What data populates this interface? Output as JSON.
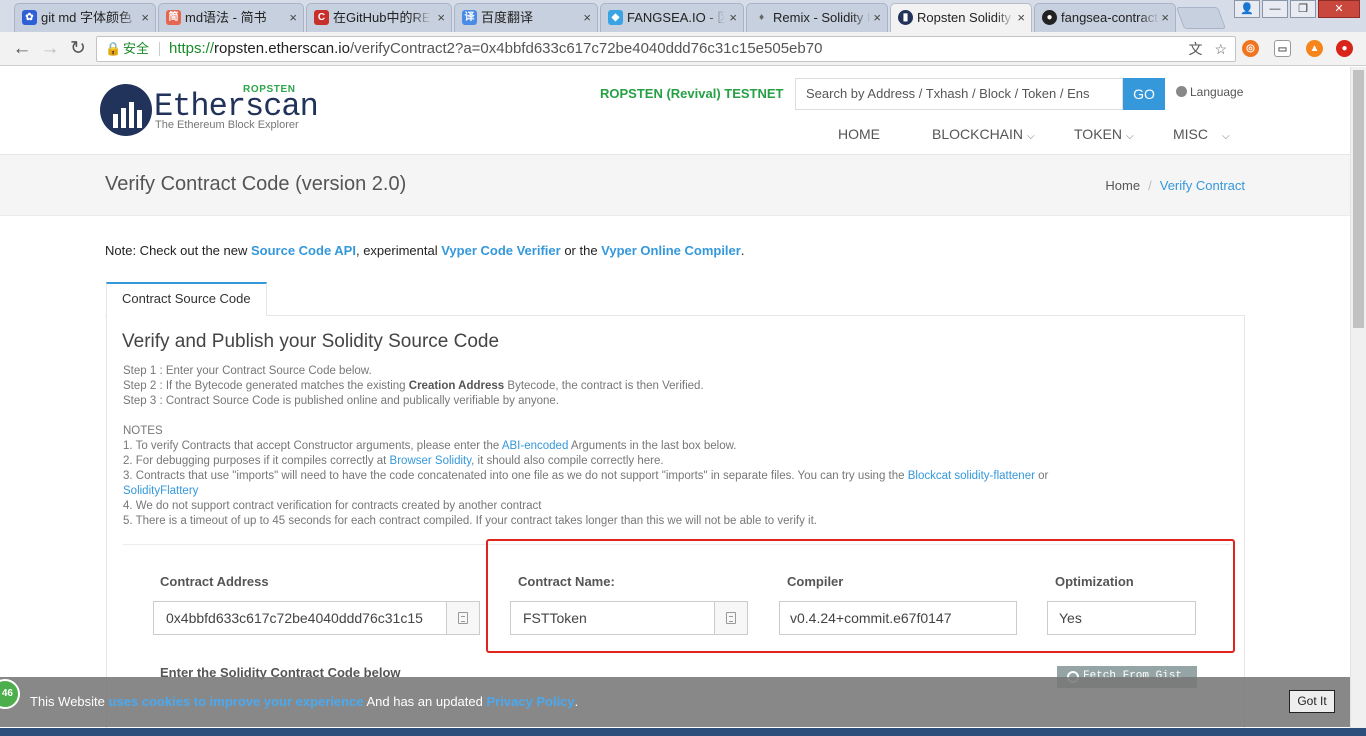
{
  "browser": {
    "tabs": [
      {
        "label": "git md 字体颜色",
        "icon": "paw-icon",
        "color": "#2e5fd6"
      },
      {
        "label": "md语法 - 简书",
        "icon": "jianshu-icon",
        "color": "#e6654f"
      },
      {
        "label": "在GitHub中的README",
        "icon": "csdn-icon",
        "color": "#c9302c"
      },
      {
        "label": "百度翻译",
        "icon": "translate-icon",
        "color": "#4a8be6"
      },
      {
        "label": "FANGSEA.IO - 区块链",
        "icon": "fangsea-icon",
        "color": "#3aa3e3"
      },
      {
        "label": "Remix - Solidity IDE",
        "icon": "ethereum-icon",
        "color": "#777777"
      },
      {
        "label": "Ropsten Solidity",
        "icon": "etherscan-icon",
        "color": "#21325b"
      },
      {
        "label": "fangsea-contract",
        "icon": "github-icon",
        "color": "#222222"
      }
    ],
    "secure_label": "安全",
    "url_scheme": "https://",
    "url_host": "ropsten.etherscan.io",
    "url_path": "/verifyContract2?a=0x4bbfd633c617c72be4040ddd76c31c15e505eb70"
  },
  "header": {
    "logo_network": "ROPSTEN",
    "logo_word": "Etherscan",
    "logo_tagline": "The Ethereum Block Explorer",
    "network_label": "ROPSTEN (Revival) TESTNET",
    "search_placeholder": "Search by Address / Txhash / Block / Token / Ens",
    "search_button": "GO",
    "language": "Language",
    "menu": [
      "HOME",
      "BLOCKCHAIN",
      "TOKEN",
      "MISC"
    ]
  },
  "page": {
    "title": "Verify Contract Code (version 2.0)",
    "breadcrumb_home": "Home",
    "breadcrumb_sep": "/",
    "breadcrumb_current": "Verify Contract"
  },
  "note": {
    "prefix": "Note: Check out the new ",
    "link1": "Source Code API",
    "mid1": ", experimental ",
    "link2": "Vyper Code Verifier",
    "mid2": " or the ",
    "link3": "Vyper Online Compiler",
    "suffix": "."
  },
  "tab_label": "Contract Source Code",
  "section": {
    "title": "Verify and Publish your Solidity Source Code",
    "step1": "Step 1 : Enter your Contract Source Code below.",
    "step2_a": "Step 2 : If the Bytecode generated matches the existing ",
    "step2_b": "Creation Address",
    "step2_c": " Bytecode, the contract is then Verified.",
    "step3": "Step 3 : Contract Source Code is published online and publically verifiable by anyone.",
    "notes_heading": "NOTES",
    "n1_a": "1. To verify Contracts that accept Constructor arguments, please enter the ",
    "n1_link": "ABI-encoded",
    "n1_b": " Arguments in the last box below.",
    "n2_a": "2. For debugging purposes if it compiles correctly at ",
    "n2_link": "Browser Solidity",
    "n2_b": ", it should also compile correctly here.",
    "n3_a": "3. Contracts that use \"imports\" will need to have the code concatenated into one file as we do not support \"imports\" in separate files. You can try using the ",
    "n3_link": "Blockcat solidity-flattener",
    "n3_b": " or",
    "n3_link2": "SolidityFlattery",
    "n4": "4. We do not support contract verification for contracts created by another contract",
    "n5": "5. There is a timeout of up to 45 seconds for each contract compiled. If your contract takes longer than this we will not be able to verify it."
  },
  "form": {
    "address_label": "Contract Address",
    "address_value": "0x4bbfd633c617c72be4040ddd76c31c15",
    "name_label": "Contract Name:",
    "name_value": "FSTToken",
    "compiler_label": "Compiler",
    "compiler_value": "v0.4.24+commit.e67f0147",
    "optimization_label": "Optimization",
    "optimization_value": "Yes",
    "code_label": "Enter the Solidity Contract Code below",
    "gist_button": "Fetch From Gist"
  },
  "cookie": {
    "t1": "This Website ",
    "l1": "uses cookies to improve your experience",
    "t2": " And has an updated ",
    "l2": "Privacy Policy",
    "t3": ".",
    "button": "Got It",
    "badge": "46"
  }
}
